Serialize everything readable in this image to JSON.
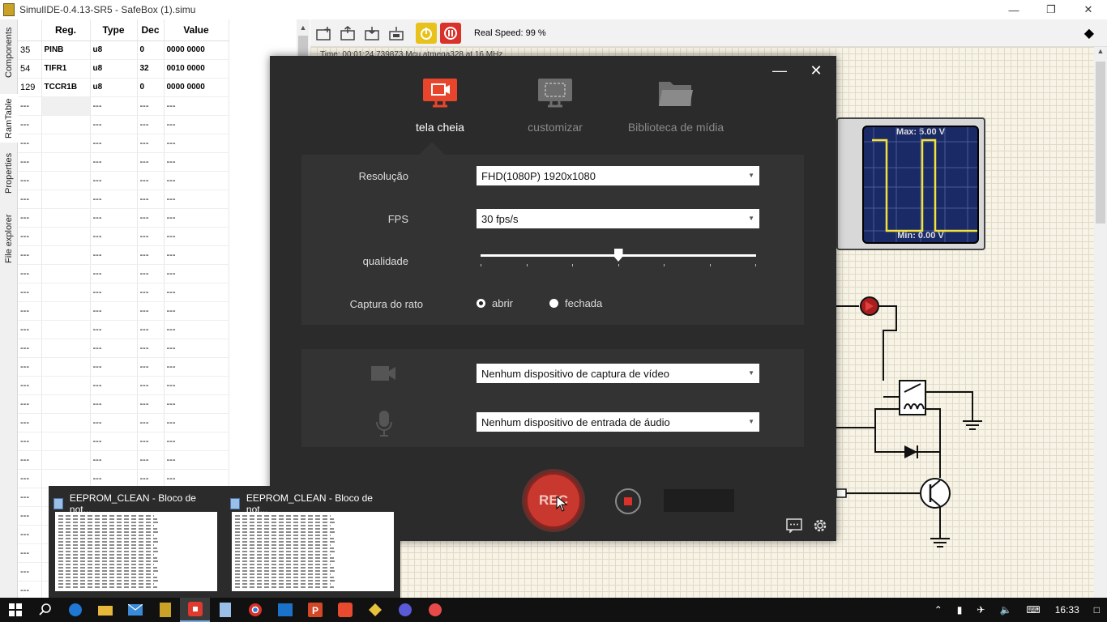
{
  "window": {
    "title": "SimulIDE-0.4.13-SR5  -  SafeBox (1).simu",
    "controls": [
      "minimize-icon",
      "restore-icon",
      "close-icon"
    ]
  },
  "side_tabs": [
    "Components",
    "RamTable",
    "Properties",
    "File explorer"
  ],
  "ram_table": {
    "columns": [
      "Reg.",
      "Type",
      "Dec",
      "Value"
    ],
    "rows": [
      {
        "addr": "35",
        "reg": "PINB",
        "type": "u8",
        "dec": "0",
        "value": "0000 0000"
      },
      {
        "addr": "54",
        "reg": "TIFR1",
        "type": "u8",
        "dec": "32",
        "value": "0010 0000"
      },
      {
        "addr": "129",
        "reg": "TCCR1B",
        "type": "u8",
        "dec": "0",
        "value": "0000 0000"
      }
    ],
    "empty_placeholder": "---",
    "empty_rows": 27
  },
  "toolbar": {
    "icons": [
      "new-circuit-icon",
      "open-circuit-icon",
      "save-circuit-icon",
      "save-as-icon",
      "power-icon",
      "pause-icon"
    ],
    "real_speed": "Real Speed: 99 %"
  },
  "canvas": {
    "hint_text": "Time: 00:01:24.739873       Mcu atmega328 at 16 MHz"
  },
  "oscilloscope": {
    "max_label": "Max: 5.00 V",
    "min_label": "Min: 0.00 V"
  },
  "recorder": {
    "tabs": [
      {
        "label": "tela cheia",
        "icon": "screen-record-icon",
        "active": true
      },
      {
        "label": "customizar",
        "icon": "custom-area-icon",
        "active": false
      },
      {
        "label": "Biblioteca de mídia",
        "icon": "folder-icon",
        "active": false
      }
    ],
    "settings": {
      "resolution_label": "Resolução",
      "resolution_value": "FHD(1080P)   1920x1080",
      "fps_label": "FPS",
      "fps_value": "30 fps/s",
      "quality_label": "qualidade",
      "quality_level": 0.5,
      "mouse_capture_label": "Captura do rato",
      "mouse_options": [
        {
          "label": "abrir",
          "selected": true
        },
        {
          "label": "fechada",
          "selected": false
        }
      ]
    },
    "devices": {
      "video": "Nenhum dispositivo de captura de vídeo",
      "audio": "Nenhum dispositivo de entrada de áudio"
    },
    "rec_label": "REC"
  },
  "taskbar_previews": [
    {
      "title": "EEPROM_CLEAN - Bloco de not..."
    },
    {
      "title": "EEPROM_CLEAN - Bloco de not..."
    }
  ],
  "taskbar": {
    "apps": [
      "windows-start-icon",
      "search-icon",
      "edge-icon",
      "file-explorer-icon",
      "mail-icon",
      "simulide-icon",
      "recorder-icon",
      "notepad-icon",
      "chrome-icon",
      "store-icon",
      "powerpoint-icon",
      "app-icon",
      "arduino-icon",
      "media-icon",
      "game-icon"
    ],
    "clock": "16:33"
  },
  "colors": {
    "recorder_bg": "#2b2b2b",
    "recorder_panel": "#333333",
    "accent_red": "#e03a2f",
    "scope_screen": "#1a2a66",
    "scope_trace": "#f2e23a"
  }
}
